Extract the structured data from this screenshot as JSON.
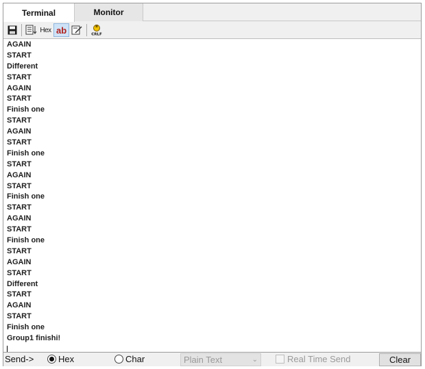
{
  "tabs": [
    {
      "label": "Terminal",
      "active": true
    },
    {
      "label": "Monitor",
      "active": false
    }
  ],
  "toolbar": {
    "hex_label": "Hex",
    "ab_label": "ab",
    "icons": [
      "save-icon",
      "display-format-icon",
      "hex-toggle",
      "ascii-toggle",
      "edit-icon",
      "crlf-icon"
    ]
  },
  "output": {
    "lines": [
      "AGAIN",
      "START",
      "Different",
      "START",
      "AGAIN",
      "START",
      "Finish one",
      "START",
      "AGAIN",
      "START",
      "Finish one",
      "START",
      "AGAIN",
      "START",
      "Finish one",
      "START",
      "AGAIN",
      "START",
      "Finish one",
      "START",
      "AGAIN",
      "START",
      "Different",
      "START",
      "AGAIN",
      "START",
      "Finish one",
      "Group1 finishi!"
    ]
  },
  "sendbar": {
    "send_label": "Send->",
    "hex_radio_label": "Hex",
    "hex_selected": true,
    "char_radio_label": "Char",
    "char_selected": false,
    "format_select_value": "Plain Text",
    "realtime_label": "Real Time Send",
    "realtime_checked": false,
    "clear_label": "Clear"
  }
}
